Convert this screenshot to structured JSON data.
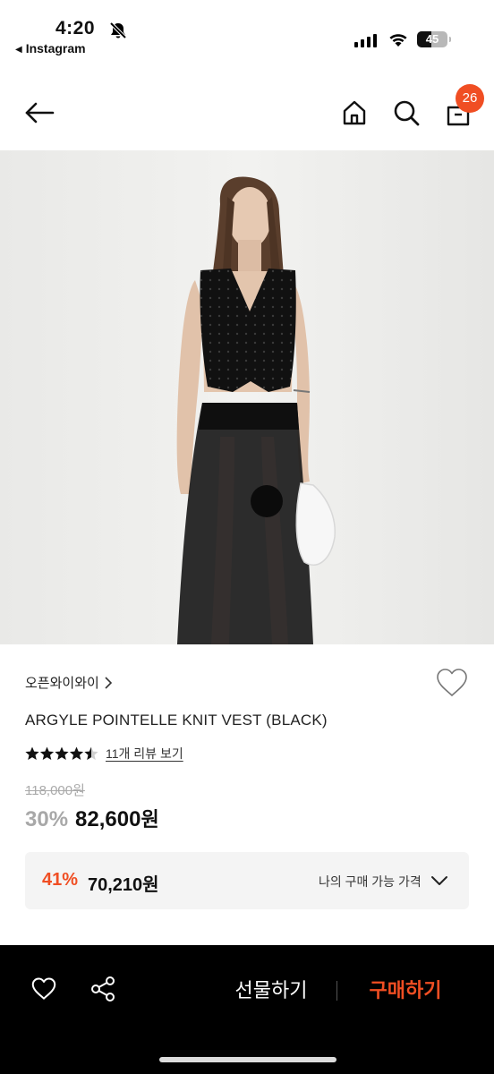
{
  "status_bar": {
    "time": "4:20",
    "back_app": "Instagram",
    "battery": "45"
  },
  "header": {
    "cart_count": "26"
  },
  "product": {
    "brand": "오픈와이와이",
    "title": "ARGYLE POINTELLE KNIT VEST (BLACK)",
    "rating": 4.5,
    "review_link": "11개 리뷰 보기",
    "original_price": "118,000원",
    "discount": "30%",
    "price_number": "82,600",
    "price_unit": "원"
  },
  "member_price": {
    "discount": "41%",
    "price": "70,210원",
    "label": "나의 구매 가능 가격"
  },
  "bottom_bar": {
    "gift_label": "선물하기",
    "buy_label": "구매하기"
  },
  "colors": {
    "accent": "#f04e23",
    "bottom_bar": "#000000"
  }
}
